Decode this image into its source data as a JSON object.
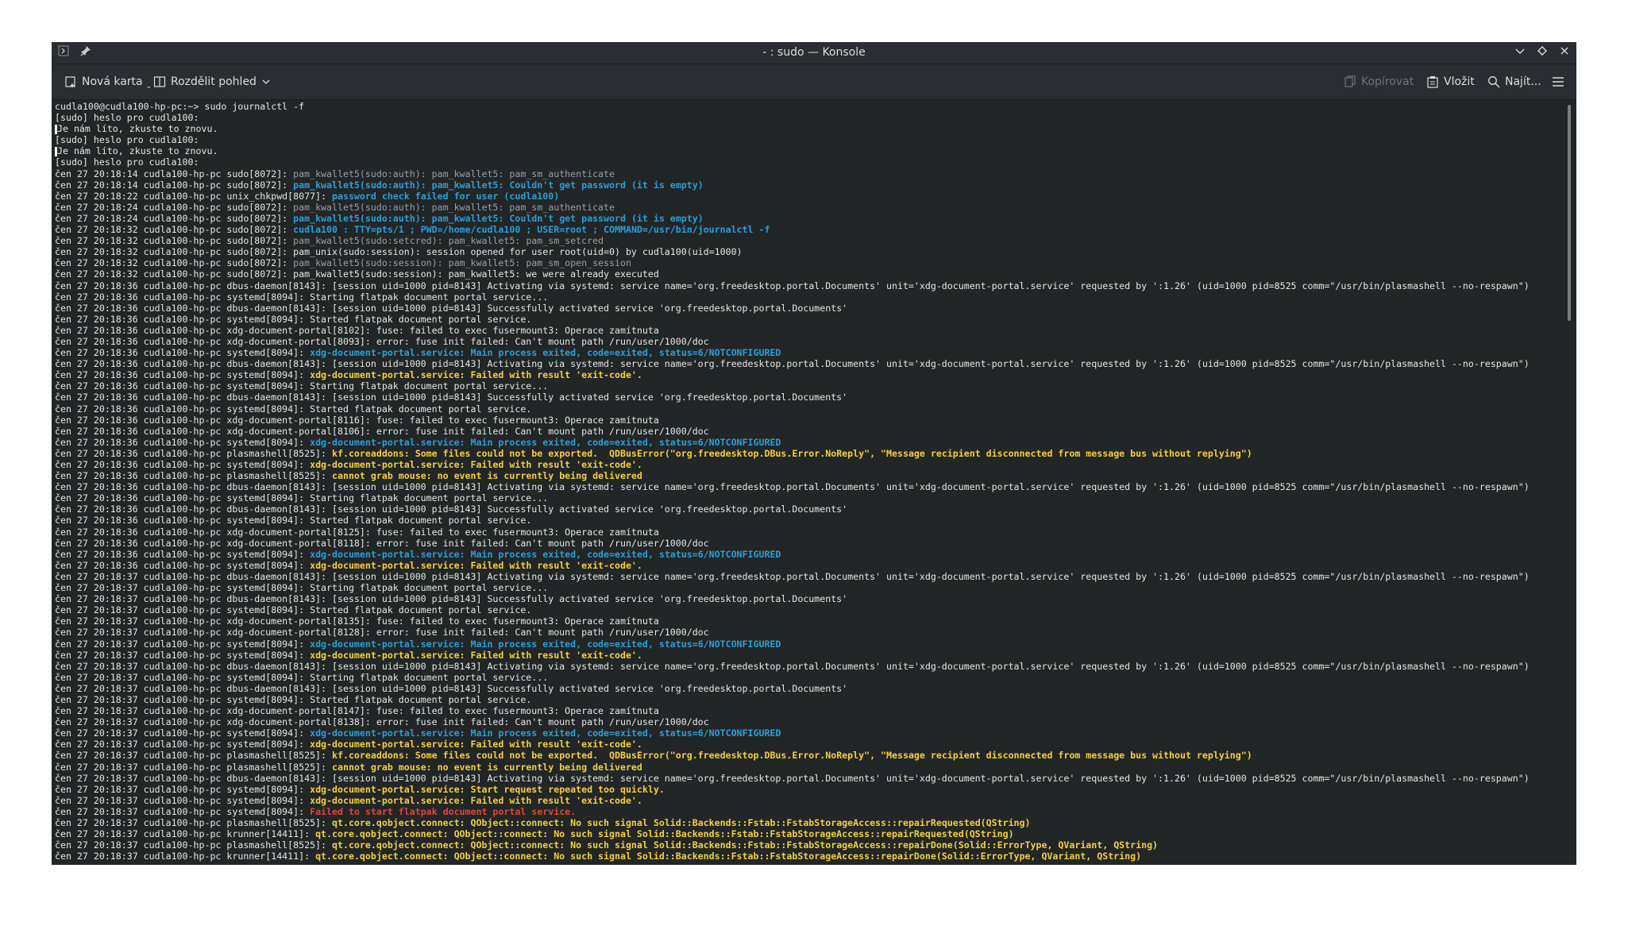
{
  "window": {
    "title": "- : sudo — Konsole"
  },
  "toolbar": {
    "new_tab": "Nová karta",
    "split_view": "Rozdělit pohled",
    "copy": "Kopírovat",
    "paste": "Vložit",
    "find": "Najít..."
  },
  "colors": {
    "background": "#232627",
    "default_text": "#e6e6e6",
    "gray": "#9a9ea0",
    "blue": "#2a9fd6",
    "yellow": "#f2d13a",
    "red": "#e0463a"
  },
  "terminal": {
    "lines": [
      {
        "segs": [
          {
            "t": "cudla100@cudla100-hp-pc:~> sudo journalctl -f"
          }
        ]
      },
      {
        "segs": [
          {
            "t": "[sudo] heslo pro cudla100:"
          }
        ]
      },
      {
        "cursor": true,
        "segs": [
          {
            "t": "Je nám líto, zkuste to znovu."
          }
        ]
      },
      {
        "segs": [
          {
            "t": "[sudo] heslo pro cudla100:"
          }
        ]
      },
      {
        "cursor": true,
        "segs": [
          {
            "t": "Je nám líto, zkuste to znovu."
          }
        ]
      },
      {
        "segs": [
          {
            "t": "[sudo] heslo pro cudla100:"
          }
        ]
      },
      {
        "segs": [
          {
            "t": "čen 27 20:18:14 cudla100-hp-pc sudo[8072]: "
          },
          {
            "t": "pam_kwallet5(sudo:auth): pam_kwallet5: pam_sm_authenticate",
            "c": "g"
          }
        ]
      },
      {
        "segs": [
          {
            "t": "čen 27 20:18:14 cudla100-hp-pc sudo[8072]: "
          },
          {
            "t": "pam_kwallet5(sudo:auth): pam_kwallet5: Couldn't get password (it is empty)",
            "c": "b"
          }
        ]
      },
      {
        "segs": [
          {
            "t": "čen 27 20:18:22 cudla100-hp-pc unix_chkpwd[8077]: "
          },
          {
            "t": "password check failed for user (cudla100)",
            "c": "b"
          }
        ]
      },
      {
        "segs": [
          {
            "t": "čen 27 20:18:24 cudla100-hp-pc sudo[8072]: "
          },
          {
            "t": "pam_kwallet5(sudo:auth): pam_kwallet5: pam_sm_authenticate",
            "c": "g"
          }
        ]
      },
      {
        "segs": [
          {
            "t": "čen 27 20:18:24 cudla100-hp-pc sudo[8072]: "
          },
          {
            "t": "pam_kwallet5(sudo:auth): pam_kwallet5: Couldn't get password (it is empty)",
            "c": "b"
          }
        ]
      },
      {
        "segs": [
          {
            "t": "čen 27 20:18:32 cudla100-hp-pc sudo[8072]: "
          },
          {
            "t": "cudla100 : TTY=pts/1 ; PWD=/home/cudla100 ; USER=root ; COMMAND=/usr/bin/journalctl -f",
            "c": "b"
          }
        ]
      },
      {
        "segs": [
          {
            "t": "čen 27 20:18:32 cudla100-hp-pc sudo[8072]: "
          },
          {
            "t": "pam_kwallet5(sudo:setcred): pam_kwallet5: pam_sm_setcred",
            "c": "g"
          }
        ]
      },
      {
        "segs": [
          {
            "t": "čen 27 20:18:32 cudla100-hp-pc sudo[8072]: pam_unix(sudo:session): session opened for user root(uid=0) by cudla100(uid=1000)"
          }
        ]
      },
      {
        "segs": [
          {
            "t": "čen 27 20:18:32 cudla100-hp-pc sudo[8072]: "
          },
          {
            "t": "pam_kwallet5(sudo:session): pam_kwallet5: pam_sm_open_session",
            "c": "g"
          }
        ]
      },
      {
        "segs": [
          {
            "t": "čen 27 20:18:32 cudla100-hp-pc sudo[8072]: pam_kwallet5(sudo:session): pam_kwallet5: we were already executed"
          }
        ]
      },
      {
        "segs": [
          {
            "t": "čen 27 20:18:36 cudla100-hp-pc dbus-daemon[8143]: [session uid=1000 pid=8143] Activating via systemd: service name='org.freedesktop.portal.Documents' unit='xdg-document-portal.service' requested by ':1.26' (uid=1000 pid=8525 comm=\"/usr/bin/plasmashell --no-respawn\")"
          }
        ]
      },
      {
        "segs": [
          {
            "t": "čen 27 20:18:36 cudla100-hp-pc systemd[8094]: Starting flatpak document portal service..."
          }
        ]
      },
      {
        "segs": [
          {
            "t": "čen 27 20:18:36 cudla100-hp-pc dbus-daemon[8143]: [session uid=1000 pid=8143] Successfully activated service 'org.freedesktop.portal.Documents'"
          }
        ]
      },
      {
        "segs": [
          {
            "t": "čen 27 20:18:36 cudla100-hp-pc systemd[8094]: Started flatpak document portal service."
          }
        ]
      },
      {
        "segs": [
          {
            "t": "čen 27 20:18:36 cudla100-hp-pc xdg-document-portal[8102]: fuse: failed to exec fusermount3: Operace zamítnuta"
          }
        ]
      },
      {
        "segs": [
          {
            "t": "čen 27 20:18:36 cudla100-hp-pc xdg-document-portal[8093]: error: fuse init failed: Can't mount path /run/user/1000/doc"
          }
        ]
      },
      {
        "segs": [
          {
            "t": "čen 27 20:18:36 cudla100-hp-pc systemd[8094]: "
          },
          {
            "t": "xdg-document-portal.service: Main process exited, code=exited, status=6/NOTCONFIGURED",
            "c": "b"
          }
        ]
      },
      {
        "segs": [
          {
            "t": "čen 27 20:18:36 cudla100-hp-pc dbus-daemon[8143]: [session uid=1000 pid=8143] Activating via systemd: service name='org.freedesktop.portal.Documents' unit='xdg-document-portal.service' requested by ':1.26' (uid=1000 pid=8525 comm=\"/usr/bin/plasmashell --no-respawn\")"
          }
        ]
      },
      {
        "segs": [
          {
            "t": "čen 27 20:18:36 cudla100-hp-pc systemd[8094]: "
          },
          {
            "t": "xdg-document-portal.service: Failed with result 'exit-code'.",
            "c": "y"
          }
        ]
      },
      {
        "segs": [
          {
            "t": "čen 27 20:18:36 cudla100-hp-pc systemd[8094]: Starting flatpak document portal service..."
          }
        ]
      },
      {
        "segs": [
          {
            "t": "čen 27 20:18:36 cudla100-hp-pc dbus-daemon[8143]: [session uid=1000 pid=8143] Successfully activated service 'org.freedesktop.portal.Documents'"
          }
        ]
      },
      {
        "segs": [
          {
            "t": "čen 27 20:18:36 cudla100-hp-pc systemd[8094]: Started flatpak document portal service."
          }
        ]
      },
      {
        "segs": [
          {
            "t": "čen 27 20:18:36 cudla100-hp-pc xdg-document-portal[8116]: fuse: failed to exec fusermount3: Operace zamítnuta"
          }
        ]
      },
      {
        "segs": [
          {
            "t": "čen 27 20:18:36 cudla100-hp-pc xdg-document-portal[8106]: error: fuse init failed: Can't mount path /run/user/1000/doc"
          }
        ]
      },
      {
        "segs": [
          {
            "t": "čen 27 20:18:36 cudla100-hp-pc systemd[8094]: "
          },
          {
            "t": "xdg-document-portal.service: Main process exited, code=exited, status=6/NOTCONFIGURED",
            "c": "b"
          }
        ]
      },
      {
        "segs": [
          {
            "t": "čen 27 20:18:36 cudla100-hp-pc plasmashell[8525]: "
          },
          {
            "t": "kf.coreaddons: Some files could not be exported.  QDBusError(\"org.freedesktop.DBus.Error.NoReply\", \"Message recipient disconnected from message bus without replying\")",
            "c": "y"
          }
        ]
      },
      {
        "segs": [
          {
            "t": "čen 27 20:18:36 cudla100-hp-pc systemd[8094]: "
          },
          {
            "t": "xdg-document-portal.service: Failed with result 'exit-code'.",
            "c": "y"
          }
        ]
      },
      {
        "segs": [
          {
            "t": "čen 27 20:18:36 cudla100-hp-pc plasmashell[8525]: "
          },
          {
            "t": "cannot grab mouse: no event is currently being delivered",
            "c": "y"
          }
        ]
      },
      {
        "segs": [
          {
            "t": "čen 27 20:18:36 cudla100-hp-pc dbus-daemon[8143]: [session uid=1000 pid=8143] Activating via systemd: service name='org.freedesktop.portal.Documents' unit='xdg-document-portal.service' requested by ':1.26' (uid=1000 pid=8525 comm=\"/usr/bin/plasmashell --no-respawn\")"
          }
        ]
      },
      {
        "segs": [
          {
            "t": "čen 27 20:18:36 cudla100-hp-pc systemd[8094]: Starting flatpak document portal service..."
          }
        ]
      },
      {
        "segs": [
          {
            "t": "čen 27 20:18:36 cudla100-hp-pc dbus-daemon[8143]: [session uid=1000 pid=8143] Successfully activated service 'org.freedesktop.portal.Documents'"
          }
        ]
      },
      {
        "segs": [
          {
            "t": "čen 27 20:18:36 cudla100-hp-pc systemd[8094]: Started flatpak document portal service."
          }
        ]
      },
      {
        "segs": [
          {
            "t": "čen 27 20:18:36 cudla100-hp-pc xdg-document-portal[8125]: fuse: failed to exec fusermount3: Operace zamítnuta"
          }
        ]
      },
      {
        "segs": [
          {
            "t": "čen 27 20:18:36 cudla100-hp-pc xdg-document-portal[8118]: error: fuse init failed: Can't mount path /run/user/1000/doc"
          }
        ]
      },
      {
        "segs": [
          {
            "t": "čen 27 20:18:36 cudla100-hp-pc systemd[8094]: "
          },
          {
            "t": "xdg-document-portal.service: Main process exited, code=exited, status=6/NOTCONFIGURED",
            "c": "b"
          }
        ]
      },
      {
        "segs": [
          {
            "t": "čen 27 20:18:36 cudla100-hp-pc systemd[8094]: "
          },
          {
            "t": "xdg-document-portal.service: Failed with result 'exit-code'.",
            "c": "y"
          }
        ]
      },
      {
        "segs": [
          {
            "t": "čen 27 20:18:37 cudla100-hp-pc dbus-daemon[8143]: [session uid=1000 pid=8143] Activating via systemd: service name='org.freedesktop.portal.Documents' unit='xdg-document-portal.service' requested by ':1.26' (uid=1000 pid=8525 comm=\"/usr/bin/plasmashell --no-respawn\")"
          }
        ]
      },
      {
        "segs": [
          {
            "t": "čen 27 20:18:37 cudla100-hp-pc systemd[8094]: Starting flatpak document portal service..."
          }
        ]
      },
      {
        "segs": [
          {
            "t": "čen 27 20:18:37 cudla100-hp-pc dbus-daemon[8143]: [session uid=1000 pid=8143] Successfully activated service 'org.freedesktop.portal.Documents'"
          }
        ]
      },
      {
        "segs": [
          {
            "t": "čen 27 20:18:37 cudla100-hp-pc systemd[8094]: Started flatpak document portal service."
          }
        ]
      },
      {
        "segs": [
          {
            "t": "čen 27 20:18:37 cudla100-hp-pc xdg-document-portal[8135]: fuse: failed to exec fusermount3: Operace zamítnuta"
          }
        ]
      },
      {
        "segs": [
          {
            "t": "čen 27 20:18:37 cudla100-hp-pc xdg-document-portal[8128]: error: fuse init failed: Can't mount path /run/user/1000/doc"
          }
        ]
      },
      {
        "segs": [
          {
            "t": "čen 27 20:18:37 cudla100-hp-pc systemd[8094]: "
          },
          {
            "t": "xdg-document-portal.service: Main process exited, code=exited, status=6/NOTCONFIGURED",
            "c": "b"
          }
        ]
      },
      {
        "segs": [
          {
            "t": "čen 27 20:18:37 cudla100-hp-pc systemd[8094]: "
          },
          {
            "t": "xdg-document-portal.service: Failed with result 'exit-code'.",
            "c": "y"
          }
        ]
      },
      {
        "segs": [
          {
            "t": "čen 27 20:18:37 cudla100-hp-pc dbus-daemon[8143]: [session uid=1000 pid=8143] Activating via systemd: service name='org.freedesktop.portal.Documents' unit='xdg-document-portal.service' requested by ':1.26' (uid=1000 pid=8525 comm=\"/usr/bin/plasmashell --no-respawn\")"
          }
        ]
      },
      {
        "segs": [
          {
            "t": "čen 27 20:18:37 cudla100-hp-pc systemd[8094]: Starting flatpak document portal service..."
          }
        ]
      },
      {
        "segs": [
          {
            "t": "čen 27 20:18:37 cudla100-hp-pc dbus-daemon[8143]: [session uid=1000 pid=8143] Successfully activated service 'org.freedesktop.portal.Documents'"
          }
        ]
      },
      {
        "segs": [
          {
            "t": "čen 27 20:18:37 cudla100-hp-pc systemd[8094]: Started flatpak document portal service."
          }
        ]
      },
      {
        "segs": [
          {
            "t": "čen 27 20:18:37 cudla100-hp-pc xdg-document-portal[8147]: fuse: failed to exec fusermount3: Operace zamítnuta"
          }
        ]
      },
      {
        "segs": [
          {
            "t": "čen 27 20:18:37 cudla100-hp-pc xdg-document-portal[8138]: error: fuse init failed: Can't mount path /run/user/1000/doc"
          }
        ]
      },
      {
        "segs": [
          {
            "t": "čen 27 20:18:37 cudla100-hp-pc systemd[8094]: "
          },
          {
            "t": "xdg-document-portal.service: Main process exited, code=exited, status=6/NOTCONFIGURED",
            "c": "b"
          }
        ]
      },
      {
        "segs": [
          {
            "t": "čen 27 20:18:37 cudla100-hp-pc systemd[8094]: "
          },
          {
            "t": "xdg-document-portal.service: Failed with result 'exit-code'.",
            "c": "y"
          }
        ]
      },
      {
        "segs": [
          {
            "t": "čen 27 20:18:37 cudla100-hp-pc plasmashell[8525]: "
          },
          {
            "t": "kf.coreaddons: Some files could not be exported.  QDBusError(\"org.freedesktop.DBus.Error.NoReply\", \"Message recipient disconnected from message bus without replying\")",
            "c": "y"
          }
        ]
      },
      {
        "segs": [
          {
            "t": "čen 27 20:18:37 cudla100-hp-pc plasmashell[8525]: "
          },
          {
            "t": "cannot grab mouse: no event is currently being delivered",
            "c": "y"
          }
        ]
      },
      {
        "segs": [
          {
            "t": "čen 27 20:18:37 cudla100-hp-pc dbus-daemon[8143]: [session uid=1000 pid=8143] Activating via systemd: service name='org.freedesktop.portal.Documents' unit='xdg-document-portal.service' requested by ':1.26' (uid=1000 pid=8525 comm=\"/usr/bin/plasmashell --no-respawn\")"
          }
        ]
      },
      {
        "segs": [
          {
            "t": "čen 27 20:18:37 cudla100-hp-pc systemd[8094]: "
          },
          {
            "t": "xdg-document-portal.service: Start request repeated too quickly.",
            "c": "y"
          }
        ]
      },
      {
        "segs": [
          {
            "t": "čen 27 20:18:37 cudla100-hp-pc systemd[8094]: "
          },
          {
            "t": "xdg-document-portal.service: Failed with result 'exit-code'.",
            "c": "y"
          }
        ]
      },
      {
        "segs": [
          {
            "t": "čen 27 20:18:37 cudla100-hp-pc systemd[8094]: "
          },
          {
            "t": "Failed to start flatpak document portal service.",
            "c": "r"
          }
        ]
      },
      {
        "segs": [
          {
            "t": "čen 27 20:18:37 cudla100-hp-pc plasmashell[8525]: "
          },
          {
            "t": "qt.core.qobject.connect: QObject::connect: No such signal Solid::Backends::Fstab::FstabStorageAccess::repairRequested(QString)",
            "c": "y"
          }
        ]
      },
      {
        "segs": [
          {
            "t": "čen 27 20:18:37 cudla100-hp-pc krunner[14411]: "
          },
          {
            "t": "qt.core.qobject.connect: QObject::connect: No such signal Solid::Backends::Fstab::FstabStorageAccess::repairRequested(QString)",
            "c": "y"
          }
        ]
      },
      {
        "segs": [
          {
            "t": "čen 27 20:18:37 cudla100-hp-pc plasmashell[8525]: "
          },
          {
            "t": "qt.core.qobject.connect: QObject::connect: No such signal Solid::Backends::Fstab::FstabStorageAccess::repairDone(Solid::ErrorType, QVariant, QString)",
            "c": "y"
          }
        ]
      },
      {
        "segs": [
          {
            "t": "čen 27 20:18:37 cudla100-hp-pc krunner[14411]: "
          },
          {
            "t": "qt.core.qobject.connect: QObject::connect: No such signal Solid::Backends::Fstab::FstabStorageAccess::repairDone(Solid::ErrorType, QVariant, QString)",
            "c": "y"
          }
        ]
      }
    ]
  }
}
